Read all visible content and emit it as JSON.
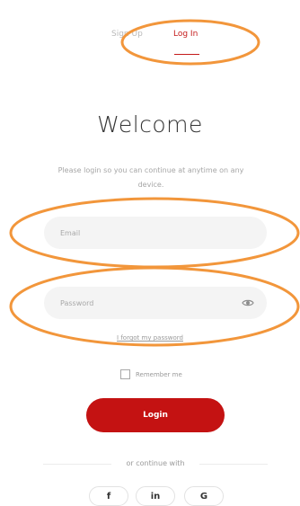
{
  "tabs": {
    "signup_label": "Sign Up",
    "login_label": "Log In",
    "active": "Log In"
  },
  "page": {
    "title": "Welcome",
    "subtitle": "Please login so you can continue at anytime on any device."
  },
  "form": {
    "email_placeholder": "Email",
    "password_placeholder": "Password",
    "forgot_password_label": "I forgot my password",
    "remember_label": "Remember me",
    "login_button_label": "Login"
  },
  "social": {
    "continue_label": "or continue with",
    "buttons": [
      {
        "label": "f",
        "icon": "facebook-icon"
      },
      {
        "label": "in",
        "icon": "linkedin-icon"
      },
      {
        "label": "G",
        "icon": "google-icon"
      }
    ]
  },
  "colors": {
    "brand": "#c41212",
    "annotation": "#f2963b",
    "field_background": "#f4f4f4",
    "muted_text": "#9a9a9a"
  }
}
